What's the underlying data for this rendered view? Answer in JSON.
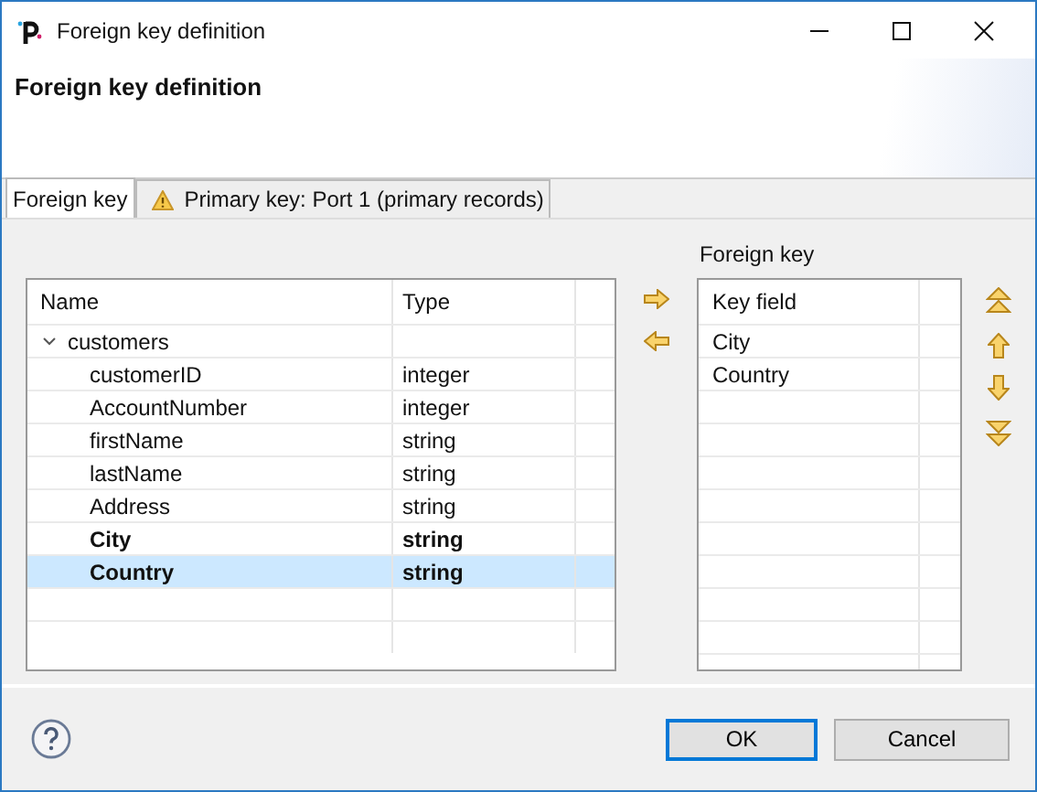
{
  "window": {
    "title": "Foreign key definition"
  },
  "header": {
    "title": "Foreign key definition"
  },
  "tabs": [
    {
      "label": "Foreign key",
      "selected": true,
      "warning": false
    },
    {
      "label": "Primary key: Port 1 (primary records)",
      "selected": false,
      "warning": true
    }
  ],
  "fields_table": {
    "columns": [
      "Name",
      "Type"
    ],
    "rows": [
      {
        "name": "customers",
        "expanded": true,
        "children": [
          {
            "name": "customerID",
            "type": "integer",
            "bold": false,
            "selected": false
          },
          {
            "name": "AccountNumber",
            "type": "integer",
            "bold": false,
            "selected": false
          },
          {
            "name": "firstName",
            "type": "string",
            "bold": false,
            "selected": false
          },
          {
            "name": "lastName",
            "type": "string",
            "bold": false,
            "selected": false
          },
          {
            "name": "Address",
            "type": "string",
            "bold": false,
            "selected": false
          },
          {
            "name": "City",
            "type": "string",
            "bold": true,
            "selected": false
          },
          {
            "name": "Country",
            "type": "string",
            "bold": true,
            "selected": true
          }
        ]
      }
    ]
  },
  "foreign_key": {
    "label": "Foreign key",
    "columns": [
      "Key field"
    ],
    "rows": [
      {
        "field": "City"
      },
      {
        "field": "Country"
      }
    ]
  },
  "buttons": [
    {
      "label": "OK",
      "default": true
    },
    {
      "label": "Cancel",
      "default": false
    }
  ]
}
